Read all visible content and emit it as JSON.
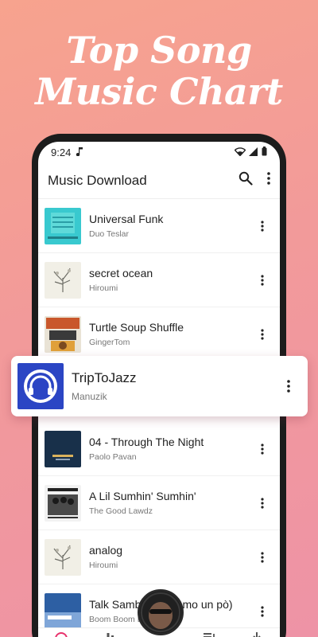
{
  "promo": {
    "line1": "Top Song",
    "line2": "Music Chart"
  },
  "status_bar": {
    "time": "9:24"
  },
  "app_bar": {
    "title": "Music Download"
  },
  "songs_top": [
    {
      "title": "Universal Funk",
      "artist": "Duo Teslar"
    },
    {
      "title": "secret ocean",
      "artist": "Hiroumi"
    },
    {
      "title": "Turtle Soup Shuffle",
      "artist": "GingerTom"
    }
  ],
  "featured": {
    "title": "TripToJazz",
    "artist": "Manuzik"
  },
  "songs_bottom": [
    {
      "title": "04 - Through The Night",
      "artist": "Paolo Pavan"
    },
    {
      "title": "A Lil Sumhin' Sumhin'",
      "artist": "The Good Lawdz"
    },
    {
      "title": "analog",
      "artist": "Hiroumi"
    },
    {
      "title": "Talk Samba (Parliamo un pò)",
      "artist": "Boom Boom Beckett"
    }
  ],
  "colors": {
    "accent": "#e8336d",
    "background_from": "#f7a38e",
    "background_to": "#ee93a6"
  },
  "bottom_nav": {
    "icons": [
      "headphones-icon",
      "bar-chart-icon",
      "now-playing-disc",
      "playlist-icon",
      "download-icon"
    ]
  }
}
